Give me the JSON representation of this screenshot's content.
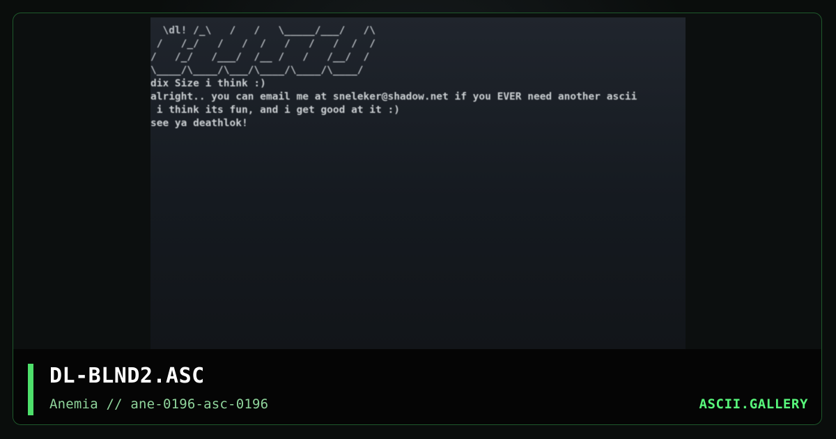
{
  "header": {
    "title": "DL-BLND2.ASC",
    "subtitle": "Anemia // ane-0196-asc-0196",
    "brand": "ASCII.GALLERY"
  },
  "art": {
    "logo_lines": [
      "  \\dl! /_\\   /   /   \\_____/___/   /\\",
      " /   /_/   /   /  /   /   /   /  /  /",
      "/   /_/   /___/  /__ /   /   /__/  /",
      "\\____/\\____/\\___/\\____/\\____/\\____/"
    ],
    "text_lines": [
      "dix Size i think :)",
      "alright.. you can email me at sneleker@shadow.net if you EVER need another ascii",
      " i think its fun, and i get good at it :)",
      "see ya deathlok!"
    ]
  },
  "colors": {
    "accent": "#4ee06b",
    "brand": "#58f77b",
    "frame_border": "#1f5a2c",
    "art_text": "#d9dde0"
  }
}
